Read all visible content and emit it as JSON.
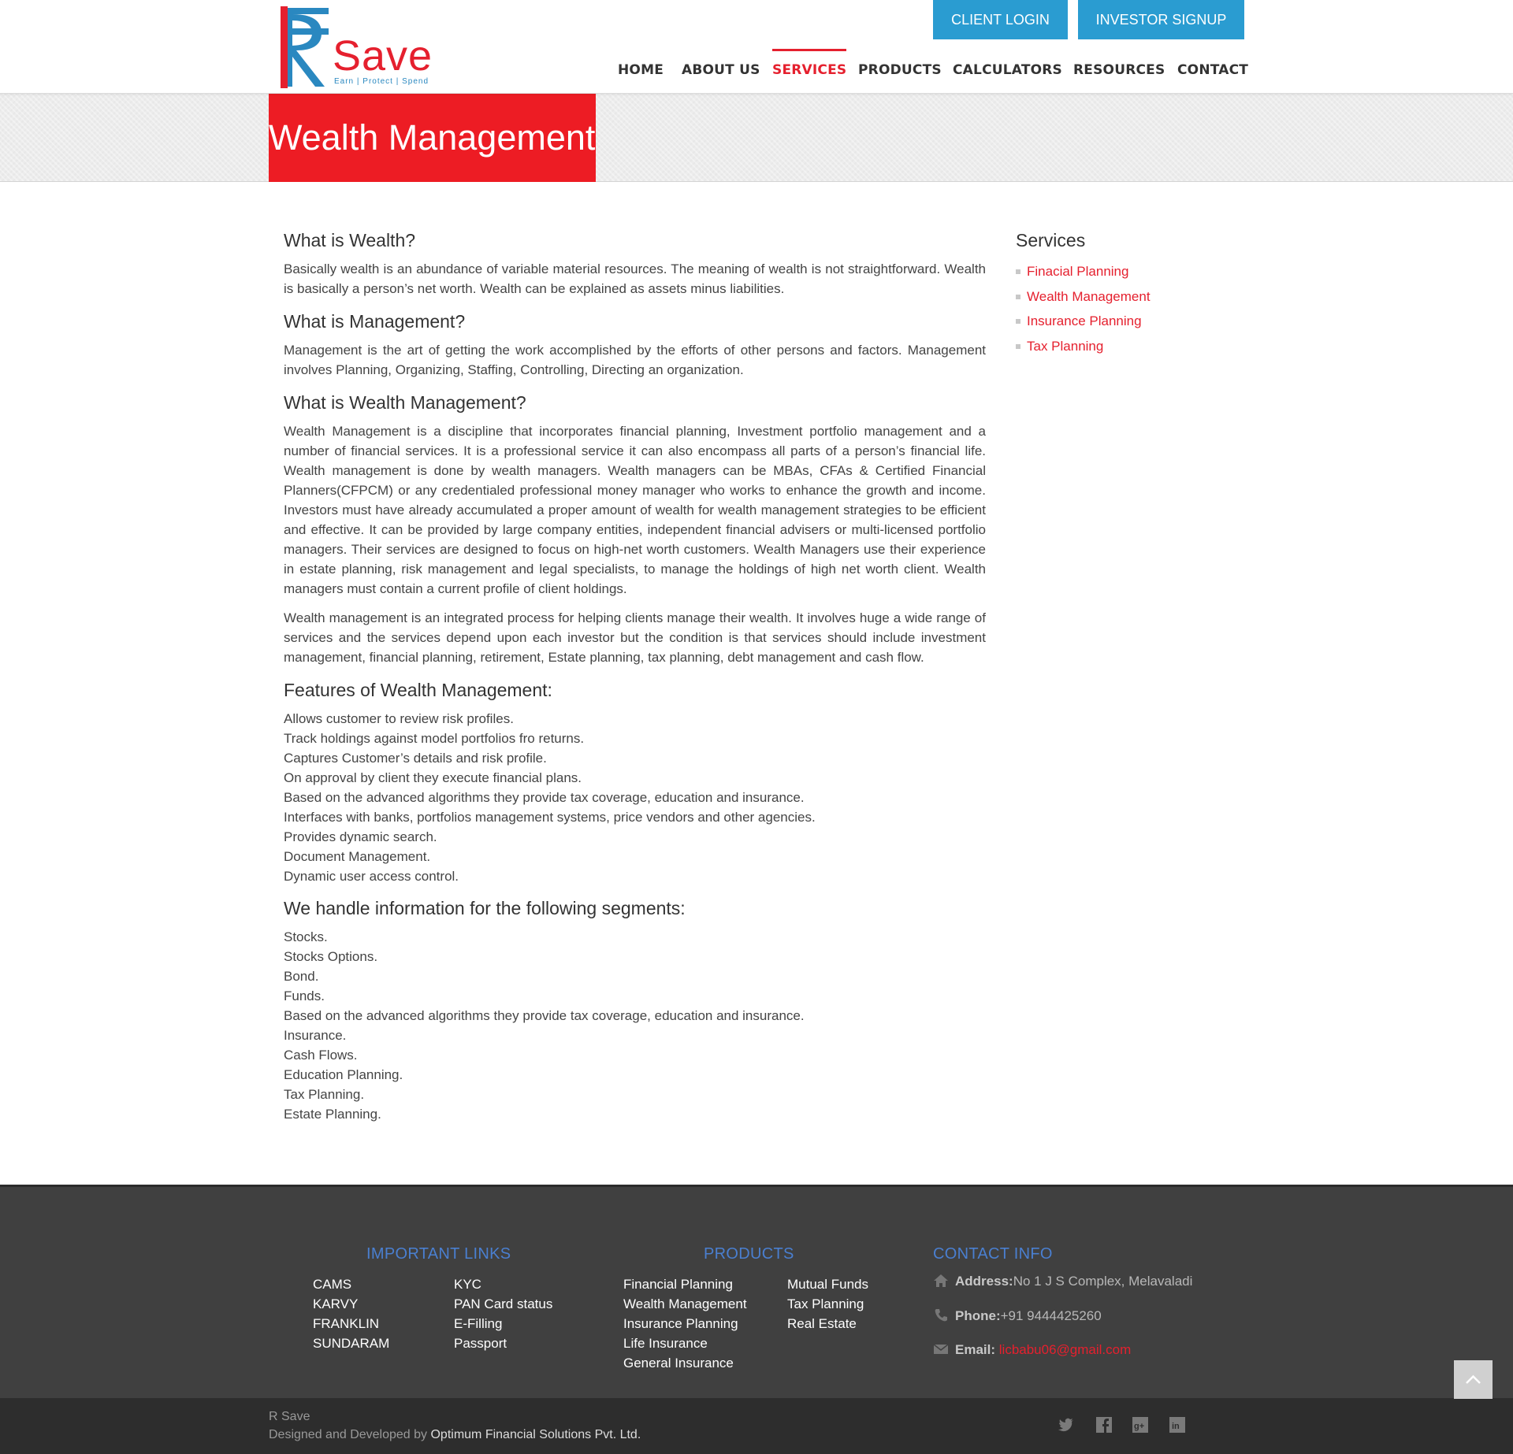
{
  "brand": {
    "logo_word": "Save",
    "logo_tagline": "Earn | Protect | Spend",
    "colors": {
      "red": "#e5202e",
      "blue": "#2a9cd1",
      "footer_bg": "#404040",
      "footer_heading": "#4a7fd0"
    }
  },
  "header": {
    "client_login": "CLIENT LOGIN",
    "investor_signup": "INVESTOR SIGNUP",
    "nav": [
      {
        "label": "HOME",
        "active": false
      },
      {
        "label": "ABOUT US",
        "active": false
      },
      {
        "label": "SERVICES",
        "active": true
      },
      {
        "label": "PRODUCTS",
        "active": false
      },
      {
        "label": "CALCULATORS",
        "active": false
      },
      {
        "label": "RESOURCES",
        "active": false
      },
      {
        "label": "CONTACT",
        "active": false
      }
    ]
  },
  "banner": {
    "title": "Wealth Management"
  },
  "main": {
    "h_wealth": "What is Wealth?",
    "p_wealth": "Basically wealth is an abundance of variable material resources. The meaning of wealth is not straightforward. Wealth is basically a person’s net worth. Wealth can be explained as assets minus liabilities.",
    "h_management": "What is Management?",
    "p_management": "Management is the art of getting the work accomplished by the efforts of other persons and factors. Management involves Planning, Organizing, Staffing, Controlling, Directing an organization.",
    "h_wm": "What is Wealth Management?",
    "p_wm1": "Wealth Management is a discipline that incorporates financial planning, Investment portfolio management and a number of financial services. It is a professional service it can also encompass all parts of a person’s financial life. Wealth management is done by wealth managers. Wealth managers can be MBAs, CFAs & Certified Financial Planners(CFPCM) or any credentialed professional money manager who works to enhance the growth and income. Investors must have already accumulated a proper amount of wealth for wealth management strategies to be efficient and effective. It can be provided by large company entities, independent financial advisers or multi-licensed portfolio managers. Their services are designed to focus on high-net worth customers. Wealth Managers use their experience in estate planning, risk management and legal specialists, to manage the holdings of high net worth client. Wealth managers must contain a current profile of client holdings.",
    "p_wm2": "Wealth management is an integrated process for helping clients manage their wealth. It involves huge a wide range of services and the services depend upon each investor but the condition is that services should include investment management, financial planning, retirement, Estate planning, tax planning, debt management and cash flow.",
    "h_features": "Features of Wealth Management:",
    "features": [
      "Allows customer to review risk profiles.",
      "Track holdings against model portfolios fro returns.",
      "Captures Customer’s details and risk profile.",
      "On approval by client they execute financial plans.",
      "Based on the advanced algorithms they provide tax coverage, education and insurance.",
      "Interfaces with banks, portfolios management systems, price vendors and other agencies.",
      "Provides dynamic search.",
      "Document Management.",
      "Dynamic user access control."
    ],
    "h_segments": "We handle information for the following segments:",
    "segments": [
      "Stocks.",
      "Stocks Options.",
      "Bond.",
      "Funds.",
      "Based on the advanced algorithms they provide tax coverage, education and insurance.",
      "Insurance.",
      "Cash Flows.",
      "Education Planning.",
      "Tax Planning.",
      "Estate Planning."
    ]
  },
  "sidebar": {
    "title": "Services",
    "items": [
      "Finacial Planning",
      "Wealth Management",
      "Insurance Planning",
      "Tax Planning"
    ]
  },
  "footer": {
    "links_heading": "IMPORTANT LINKS",
    "links_col1": [
      "CAMS",
      "KARVY",
      "FRANKLIN",
      "SUNDARAM"
    ],
    "links_col2": [
      "KYC",
      "PAN Card status",
      "E-Filling",
      "Passport"
    ],
    "products_heading": "PRODUCTS",
    "products_col1": [
      "Financial Planning",
      "Wealth Management",
      "Insurance Planning",
      "Life Insurance",
      "General Insurance"
    ],
    "products_col2": [
      "Mutual Funds",
      "Tax Planning",
      "Real Estate"
    ],
    "contact_heading": "CONTACT INFO",
    "address_label": "Address:",
    "address_value": "No 1 J S Complex, Melavaladi",
    "phone_label": "Phone:",
    "phone_value": "+91 9444425260",
    "email_label": "Email:",
    "email_value": "licbabu06@gmail.com",
    "icons": [
      "home-icon",
      "phone-icon",
      "envelope-icon"
    ]
  },
  "bottom": {
    "site_name": "R Save",
    "credit_prefix": "Designed and Developed by ",
    "credit_company": "Optimum Financial Solutions Pvt. Ltd.",
    "social_icons": [
      "twitter-icon",
      "facebook-icon",
      "google-plus-icon",
      "linkedin-icon"
    ]
  }
}
